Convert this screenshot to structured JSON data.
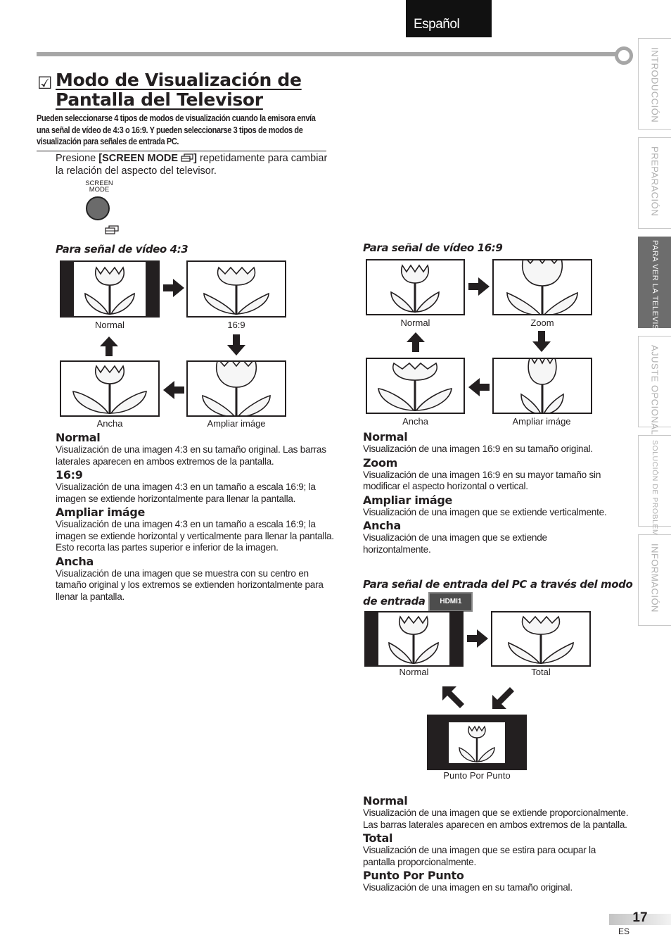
{
  "language_tab": "Español",
  "side_tabs": [
    {
      "label": "INTRODUCCIÓN",
      "active": false
    },
    {
      "label": "PREPARACIÓN",
      "active": false
    },
    {
      "label": "PARA  VER  LA  TELEVISIÓN",
      "active": true
    },
    {
      "label": "AJUSTE  OPCIONAL",
      "active": false
    },
    {
      "label": "SOLUCIÓN  DE  PROBLEMAS",
      "active": false
    },
    {
      "label": "INFORMACIÓN",
      "active": false
    }
  ],
  "title": {
    "check_icon": "☑",
    "line1": "Modo de Visualización de",
    "line2": "Pantalla del Televisor"
  },
  "intro": "Pueden seleccionarse 4 tipos de modos de visualización cuando la emisora envía una señal de vídeo de 4:3 o 16:9. Y pueden seleccionarse 3 tipos de modos de visualización para señales de entrada PC.",
  "instruction": {
    "prefix": "Presione ",
    "key": "[SCREEN MODE",
    "key_close": "]",
    "suffix": " repetidamente para cambiar la relación del aspecto del televisor."
  },
  "remote_button": {
    "label_line1": "SCREEN",
    "label_line2": "MODE",
    "icon": "screen-mode-icon"
  },
  "video43": {
    "heading": "Para señal de vídeo 4:3",
    "captions": {
      "normal": "Normal",
      "wide": "16:9",
      "expand": "Ampliar imáge",
      "ancha": "Ancha"
    },
    "items": [
      {
        "title": "Normal",
        "text": "Visualización de una imagen 4:3 en su tamaño original. Las barras laterales aparecen en ambos extremos de la pantalla."
      },
      {
        "title": "16:9",
        "text": "Visualización de una imagen 4:3 en un tamaño a escala 16:9; la imagen se extiende horizontalmente para llenar la pantalla."
      },
      {
        "title": "Ampliar imáge",
        "text": "Visualización de una imagen 4:3 en un tamaño a escala 16:9; la imagen se extiende horizontal y verticalmente para llenar la pantalla. Esto recorta las partes superior e inferior de la imagen."
      },
      {
        "title": "Ancha",
        "text": "Visualización de una imagen que se muestra con su centro en tamaño original y los extremos se extienden horizontalmente para llenar la pantalla."
      }
    ]
  },
  "video169": {
    "heading": "Para señal de vídeo 16:9",
    "captions": {
      "normal": "Normal",
      "zoom": "Zoom",
      "expand": "Ampliar imáge",
      "ancha": "Ancha"
    },
    "items": [
      {
        "title": "Normal",
        "text": "Visualización de una imagen 16:9 en su tamaño original."
      },
      {
        "title": "Zoom",
        "text": "Visualización de una imagen 16:9 en su mayor tamaño sin modificar el aspecto horizontal o vertical."
      },
      {
        "title": "Ampliar imáge",
        "text": "Visualización de una imagen que se extiende verticalmente."
      },
      {
        "title": "Ancha",
        "text": "Visualización de una imagen que se extiende horizontalmente."
      }
    ]
  },
  "pc": {
    "heading_line1": "Para señal de entrada del PC a través del modo",
    "heading_line2": "de entrada ",
    "badge": "HDMI1",
    "captions": {
      "normal": "Normal",
      "total": "Total",
      "dot": "Punto Por Punto"
    },
    "items": [
      {
        "title": "Normal",
        "text": "Visualización de una imagen que se extiende proporcionalmente. Las barras laterales aparecen en ambos extremos de la pantalla."
      },
      {
        "title": "Total",
        "text": "Visualización de una imagen que se estira para ocupar la pantalla proporcionalmente."
      },
      {
        "title": "Punto Por Punto",
        "text": "Visualización de una imagen en su tamaño original."
      }
    ]
  },
  "footer": {
    "page_number": "17",
    "lang_code": "ES"
  }
}
